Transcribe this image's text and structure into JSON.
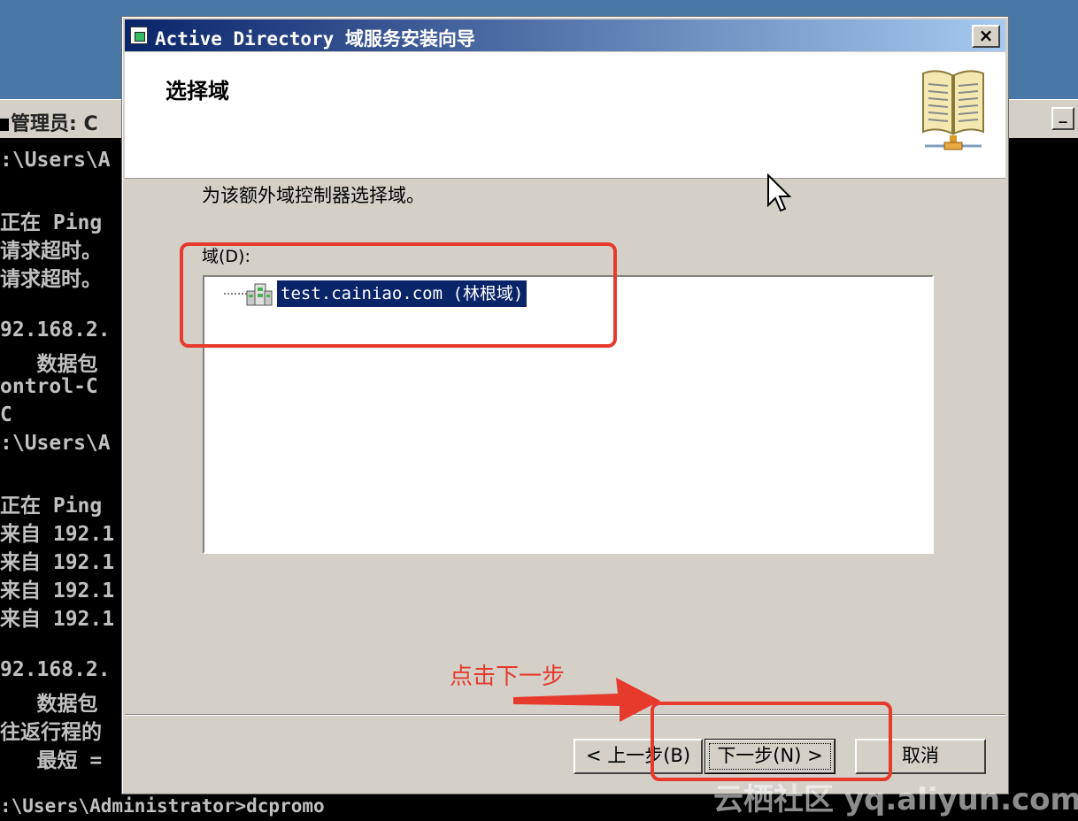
{
  "console": {
    "title": "管理员: C",
    "minimize_label": "_",
    "lines": [
      ":\\Users\\A",
      "",
      "正在 Ping",
      "请求超时。",
      "请求超时。",
      "",
      "92.168.2.",
      "   数据包",
      "ontrol-C",
      "C",
      ":\\Users\\A",
      "",
      "正在 Ping",
      "来自 192.1",
      "来自 192.1",
      "来自 192.1",
      "来自 192.1",
      "",
      "92.168.2.",
      "   数据包",
      "往返行程的",
      "   最短 ="
    ],
    "bottom_line": ":\\Users\\Administrator>dcpromo"
  },
  "wizard": {
    "title": "Active Directory 域服务安装向导",
    "close_label": "×",
    "heading": "选择域",
    "instruction": "为该额外域控制器选择域。",
    "domain_label": "域(D):",
    "domain_item": "test.cainiao.com (林根域)",
    "buttons": {
      "back": "< 上一步(B)",
      "next": "下一步(N) >",
      "cancel": "取消"
    }
  },
  "annotation": {
    "text": "点击下一步",
    "color": "#e63a2d"
  },
  "watermark": "云栖社区 yq.aliyun.com",
  "colors": {
    "titlebar_start": "#0a246a",
    "titlebar_end": "#a6caf0",
    "selection": "#0a246a",
    "dialog_face": "#d4d0c8"
  }
}
